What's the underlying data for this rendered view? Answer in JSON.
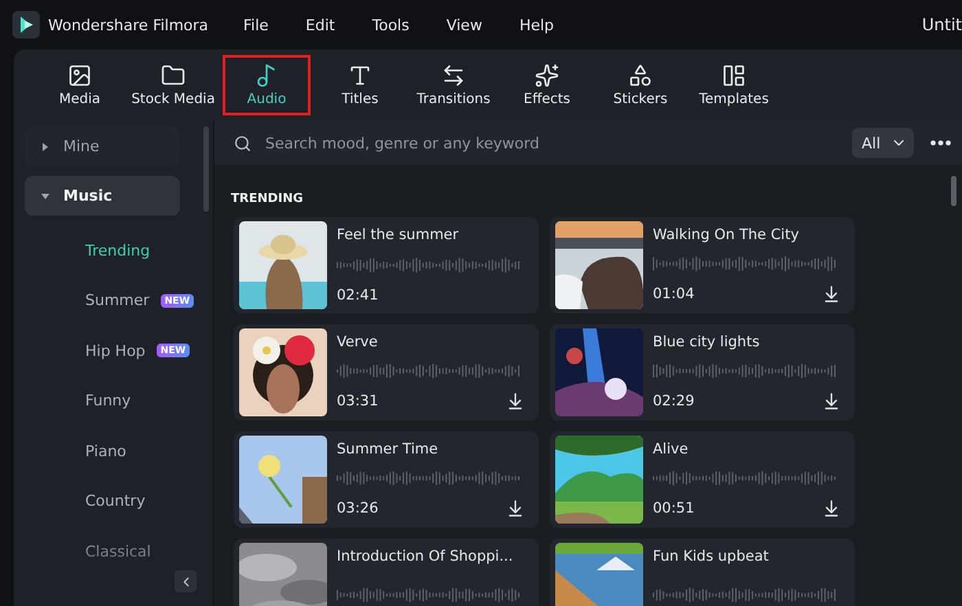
{
  "app": {
    "name": "Wondershare Filmora"
  },
  "menu": [
    "File",
    "Edit",
    "Tools",
    "View",
    "Help"
  ],
  "document_title": "Untit",
  "toolbar": [
    {
      "label": "Media",
      "selected": false,
      "highlighted": false
    },
    {
      "label": "Stock Media",
      "selected": false,
      "highlighted": false
    },
    {
      "label": "Audio",
      "selected": true,
      "highlighted": true
    },
    {
      "label": "Titles",
      "selected": false,
      "highlighted": false
    },
    {
      "label": "Transitions",
      "selected": false,
      "highlighted": false
    },
    {
      "label": "Effects",
      "selected": false,
      "highlighted": false
    },
    {
      "label": "Stickers",
      "selected": false,
      "highlighted": false
    },
    {
      "label": "Templates",
      "selected": false,
      "highlighted": false
    }
  ],
  "sidebar": {
    "items": [
      {
        "label": "Mine",
        "expanded": false,
        "selected": false
      },
      {
        "label": "Music",
        "expanded": true,
        "selected": true,
        "children": [
          {
            "label": "Trending",
            "selected": true
          },
          {
            "label": "Summer",
            "selected": false,
            "badge": "NEW"
          },
          {
            "label": "Hip Hop",
            "selected": false,
            "badge": "NEW"
          },
          {
            "label": "Funny",
            "selected": false
          },
          {
            "label": "Piano",
            "selected": false
          },
          {
            "label": "Country",
            "selected": false
          },
          {
            "label": "Classical",
            "selected": false
          }
        ]
      }
    ]
  },
  "search": {
    "placeholder": "Search mood, genre or any keyword"
  },
  "filter": {
    "value": "All"
  },
  "section": {
    "title": "TRENDING"
  },
  "tracks": [
    {
      "title": "Feel the summer",
      "duration": "02:41",
      "downloaded": true
    },
    {
      "title": "Walking On The City",
      "duration": "01:04",
      "downloaded": false
    },
    {
      "title": "Verve",
      "duration": "03:31",
      "downloaded": false
    },
    {
      "title": "Blue city lights",
      "duration": "02:29",
      "downloaded": false
    },
    {
      "title": "Summer Time",
      "duration": "03:26",
      "downloaded": false
    },
    {
      "title": "Alive",
      "duration": "00:51",
      "downloaded": false
    },
    {
      "title": "Introduction Of Shoppi..."
    },
    {
      "title": "Fun Kids upbeat"
    }
  ]
}
